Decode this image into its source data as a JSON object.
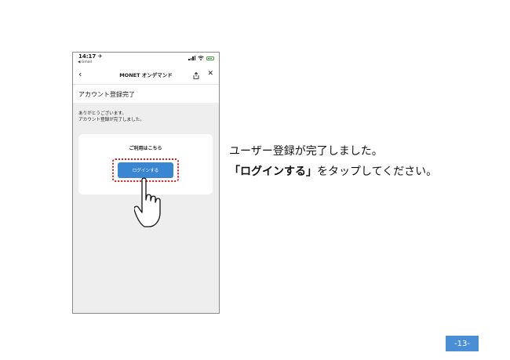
{
  "status_bar": {
    "time": "14:17 ✈",
    "back_app": "◀ Gmail"
  },
  "navbar": {
    "back_icon": "chevron-left-icon",
    "title": "MONET オンデマンド",
    "share_icon": "share-icon",
    "close_icon": "close-icon"
  },
  "page": {
    "title": "アカウント登録完了",
    "thanks_line1": "ありがとうございます。",
    "thanks_line2": "アカウント登録が完了しました。"
  },
  "card": {
    "title": "ご利用はこちら",
    "login_label": "ログインする"
  },
  "instruction": {
    "line1": "ユーザー登録が完了しました。",
    "line2_open": "「",
    "line2_bold": "ログインする",
    "line2_close": "」",
    "line2_rest": "をタップしてください。"
  },
  "page_number": "-13-",
  "colors": {
    "login_button": "#3b86d3",
    "highlight_outline": "#d21b1b",
    "page_badge": "#4a8fd6"
  }
}
